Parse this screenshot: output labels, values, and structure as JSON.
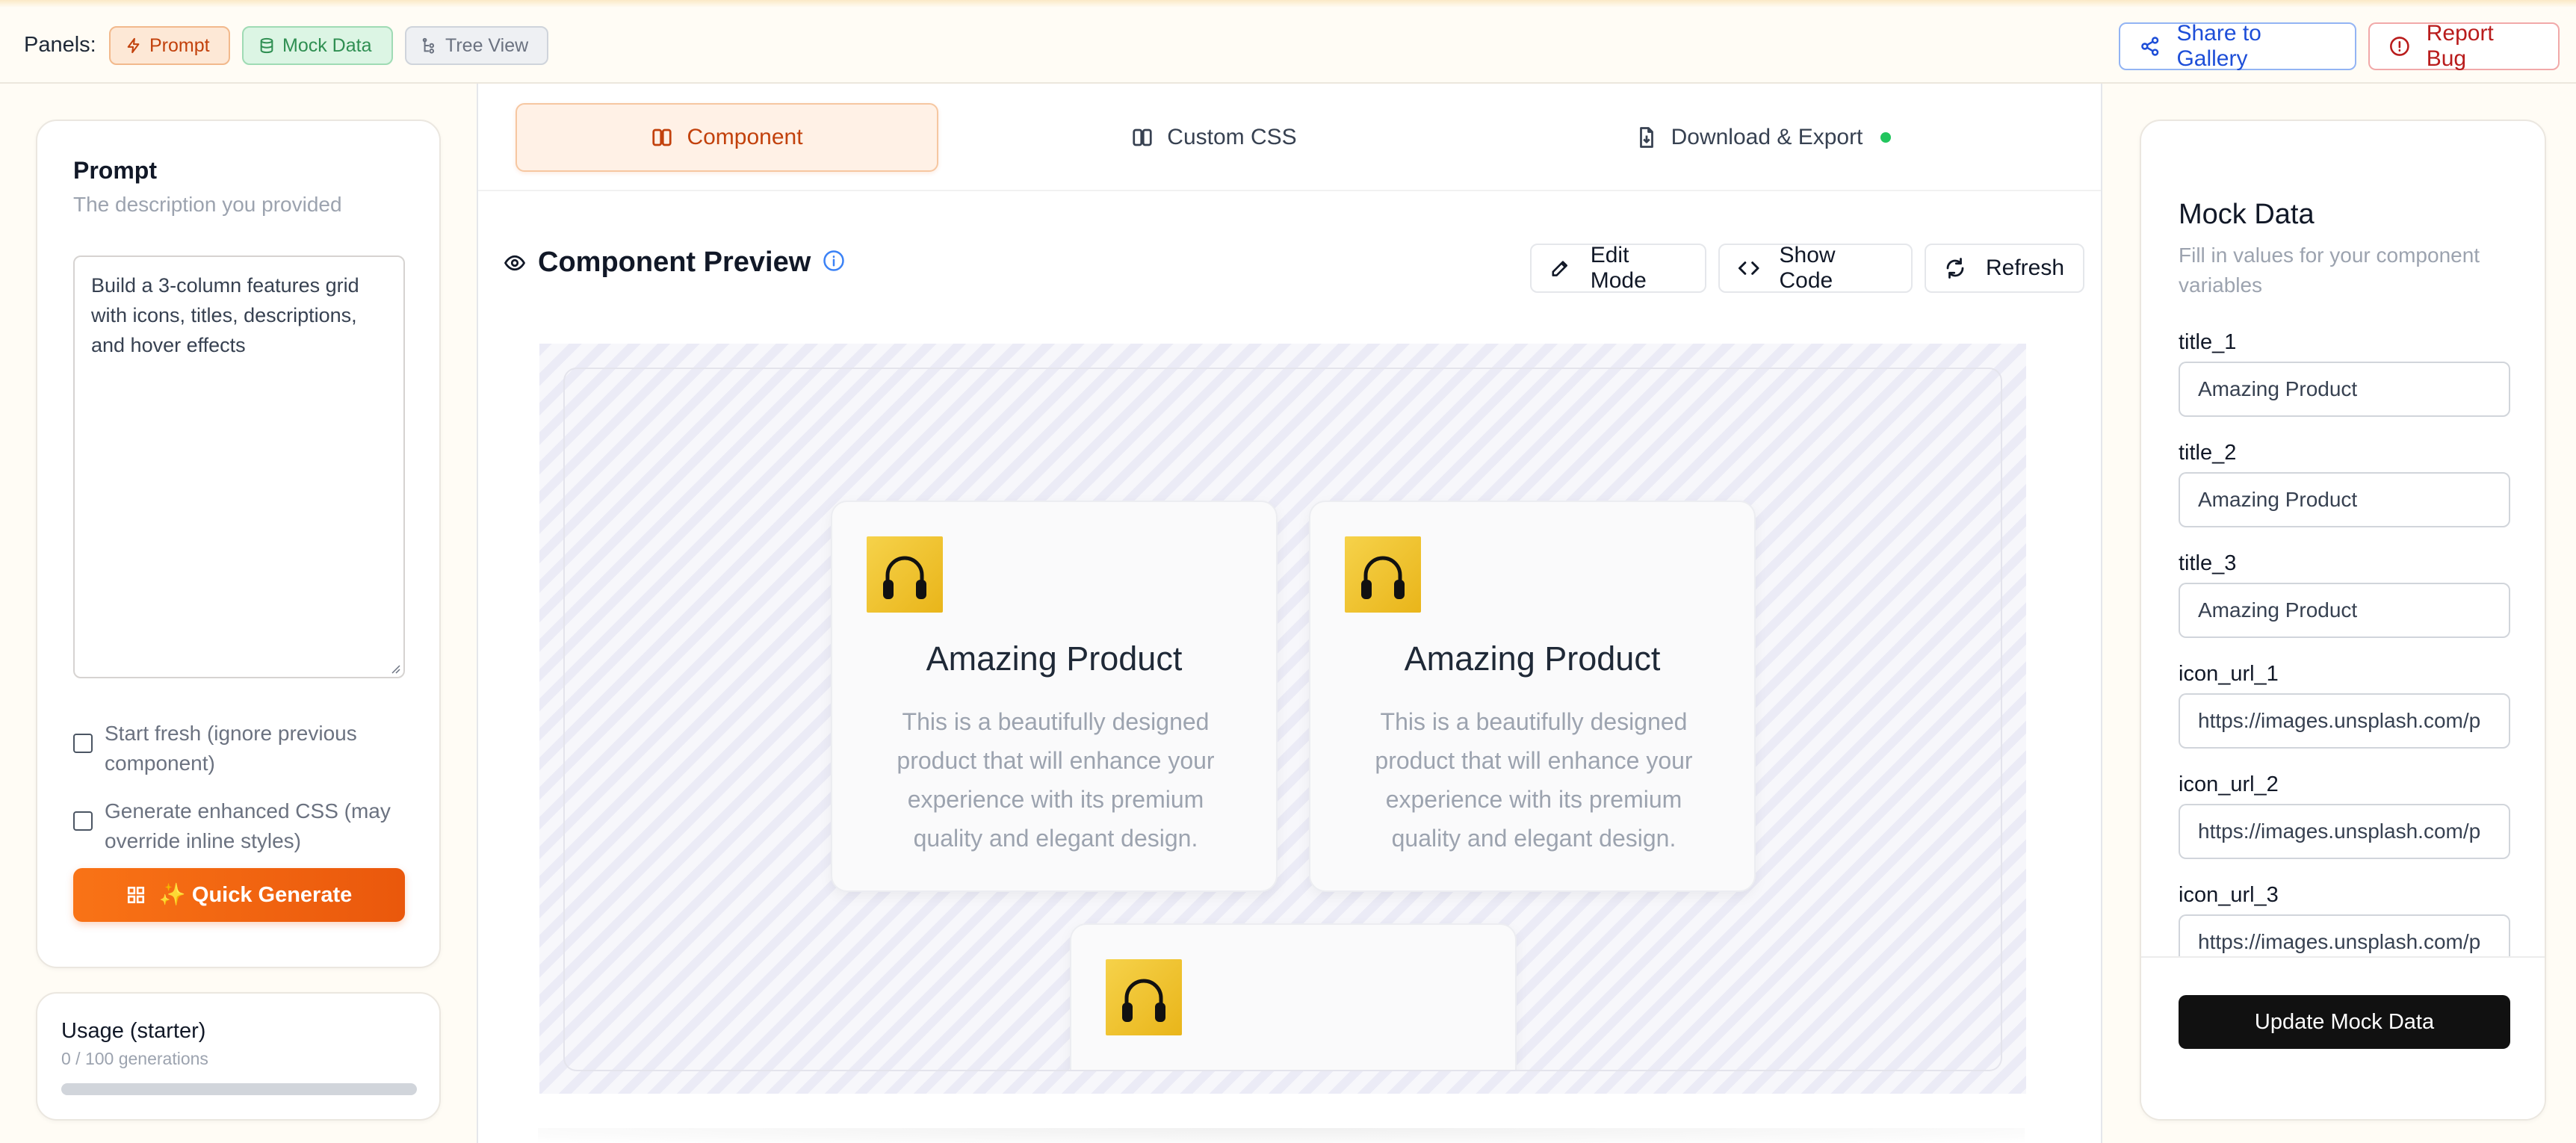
{
  "topbar": {
    "panels_label": "Panels:",
    "chips": {
      "prompt": "Prompt",
      "mock": "Mock Data",
      "tree": "Tree View"
    },
    "share_label": "Share to Gallery",
    "bug_label": "Report Bug"
  },
  "prompt_panel": {
    "title": "Prompt",
    "subtitle": "The description you provided",
    "text": "Build a 3-column features grid with icons, titles, descriptions, and hover effects",
    "options": [
      {
        "label": "Start fresh (ignore previous component)",
        "checked": false
      },
      {
        "label": "Generate enhanced CSS (may override inline styles)",
        "checked": false
      }
    ],
    "generate_label": "✨ Quick Generate"
  },
  "usage": {
    "title": "Usage (starter)",
    "detail": "0 / 100 generations",
    "fraction_used": 0
  },
  "tabs": {
    "component": "Component",
    "custom_css": "Custom CSS",
    "export": "Download & Export"
  },
  "preview": {
    "title": "Component Preview",
    "edit_label": "Edit Mode",
    "code_label": "Show Code",
    "refresh_label": "Refresh",
    "cards": [
      {
        "title": "Amazing Product",
        "description": "This is a beautifully designed product that will enhance your experience with its premium quality and elegant design."
      },
      {
        "title": "Amazing Product",
        "description": "This is a beautifully designed product that will enhance your experience with its premium quality and elegant design."
      },
      {
        "title": "",
        "description": ""
      }
    ]
  },
  "mock_data": {
    "title": "Mock Data",
    "subtitle": "Fill in values for your component variables",
    "fields": [
      {
        "label": "title_1",
        "value": "Amazing Product"
      },
      {
        "label": "title_2",
        "value": "Amazing Product"
      },
      {
        "label": "title_3",
        "value": "Amazing Product"
      },
      {
        "label": "icon_url_1",
        "value": "https://images.unsplash.com/p"
      },
      {
        "label": "icon_url_2",
        "value": "https://images.unsplash.com/p"
      },
      {
        "label": "icon_url_3",
        "value": "https://images.unsplash.com/p"
      }
    ],
    "update_label": "Update Mock Data"
  },
  "colors": {
    "accent": "#ea580c",
    "link_blue": "#1d4ed8",
    "danger": "#b91c1c",
    "success_dot": "#22c55e"
  }
}
